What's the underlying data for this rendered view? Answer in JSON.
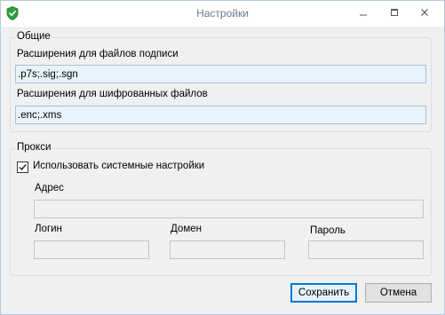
{
  "window": {
    "title": "Настройки",
    "minimize_icon": "minimize-icon",
    "maximize_icon": "maximize-icon",
    "close_icon": "close-icon",
    "app_icon": "shield-check-icon"
  },
  "general": {
    "legend": "Общие",
    "signature_label": "Расширения для файлов подписи",
    "signature_value": ".p7s;.sig;.sgn",
    "encrypted_label": "Расширения для шифрованных файлов",
    "encrypted_value": ".enc;.xms"
  },
  "proxy": {
    "legend": "Прокси",
    "use_system_label": "Использовать системные настройки",
    "use_system_checked": true,
    "address_label": "Адрес",
    "address_value": "",
    "login_label": "Логин",
    "login_value": "",
    "domain_label": "Домен",
    "domain_value": "",
    "password_label": "Пароль",
    "password_value": ""
  },
  "buttons": {
    "save_label": "Сохранить",
    "cancel_label": "Отмена"
  },
  "colors": {
    "accent": "#0078d7",
    "icon_green": "#2e9e3e",
    "highlight_field": "#e8f3fc"
  }
}
